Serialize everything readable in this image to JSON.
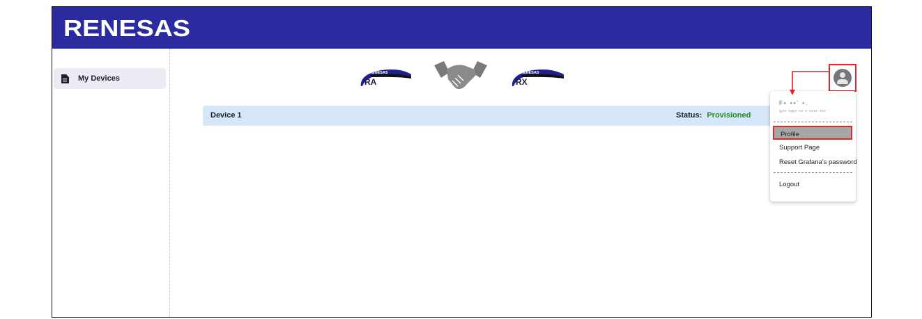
{
  "header": {
    "brand": "RENESAS",
    "brand_color": "#2b2a9e"
  },
  "sidebar": {
    "items": [
      {
        "label": "My Devices",
        "icon": "document-icon",
        "active": true
      }
    ]
  },
  "partner_logos": {
    "left_badge_brand": "RENESAS",
    "left_badge_text": "RA",
    "center_icon": "handshake-icon",
    "right_badge_brand": "RENESAS",
    "right_badge_text": "RX"
  },
  "devices": [
    {
      "name": "Device 1",
      "status_label": "Status:",
      "status_value": "Provisioned"
    }
  ],
  "account_menu": {
    "avatar_icon": "user-avatar-icon",
    "user_name": "F• ••' •.",
    "user_email": "S•• •m• •• • •••• •••",
    "items": [
      "Profile",
      "Support Page",
      "Reset Grafana's password",
      "Logout"
    ],
    "highlighted_item": "Profile"
  },
  "colors": {
    "status_ok": "#228a22",
    "highlight_box": "#e0242a",
    "device_row_bg": "#d5e7f9"
  }
}
